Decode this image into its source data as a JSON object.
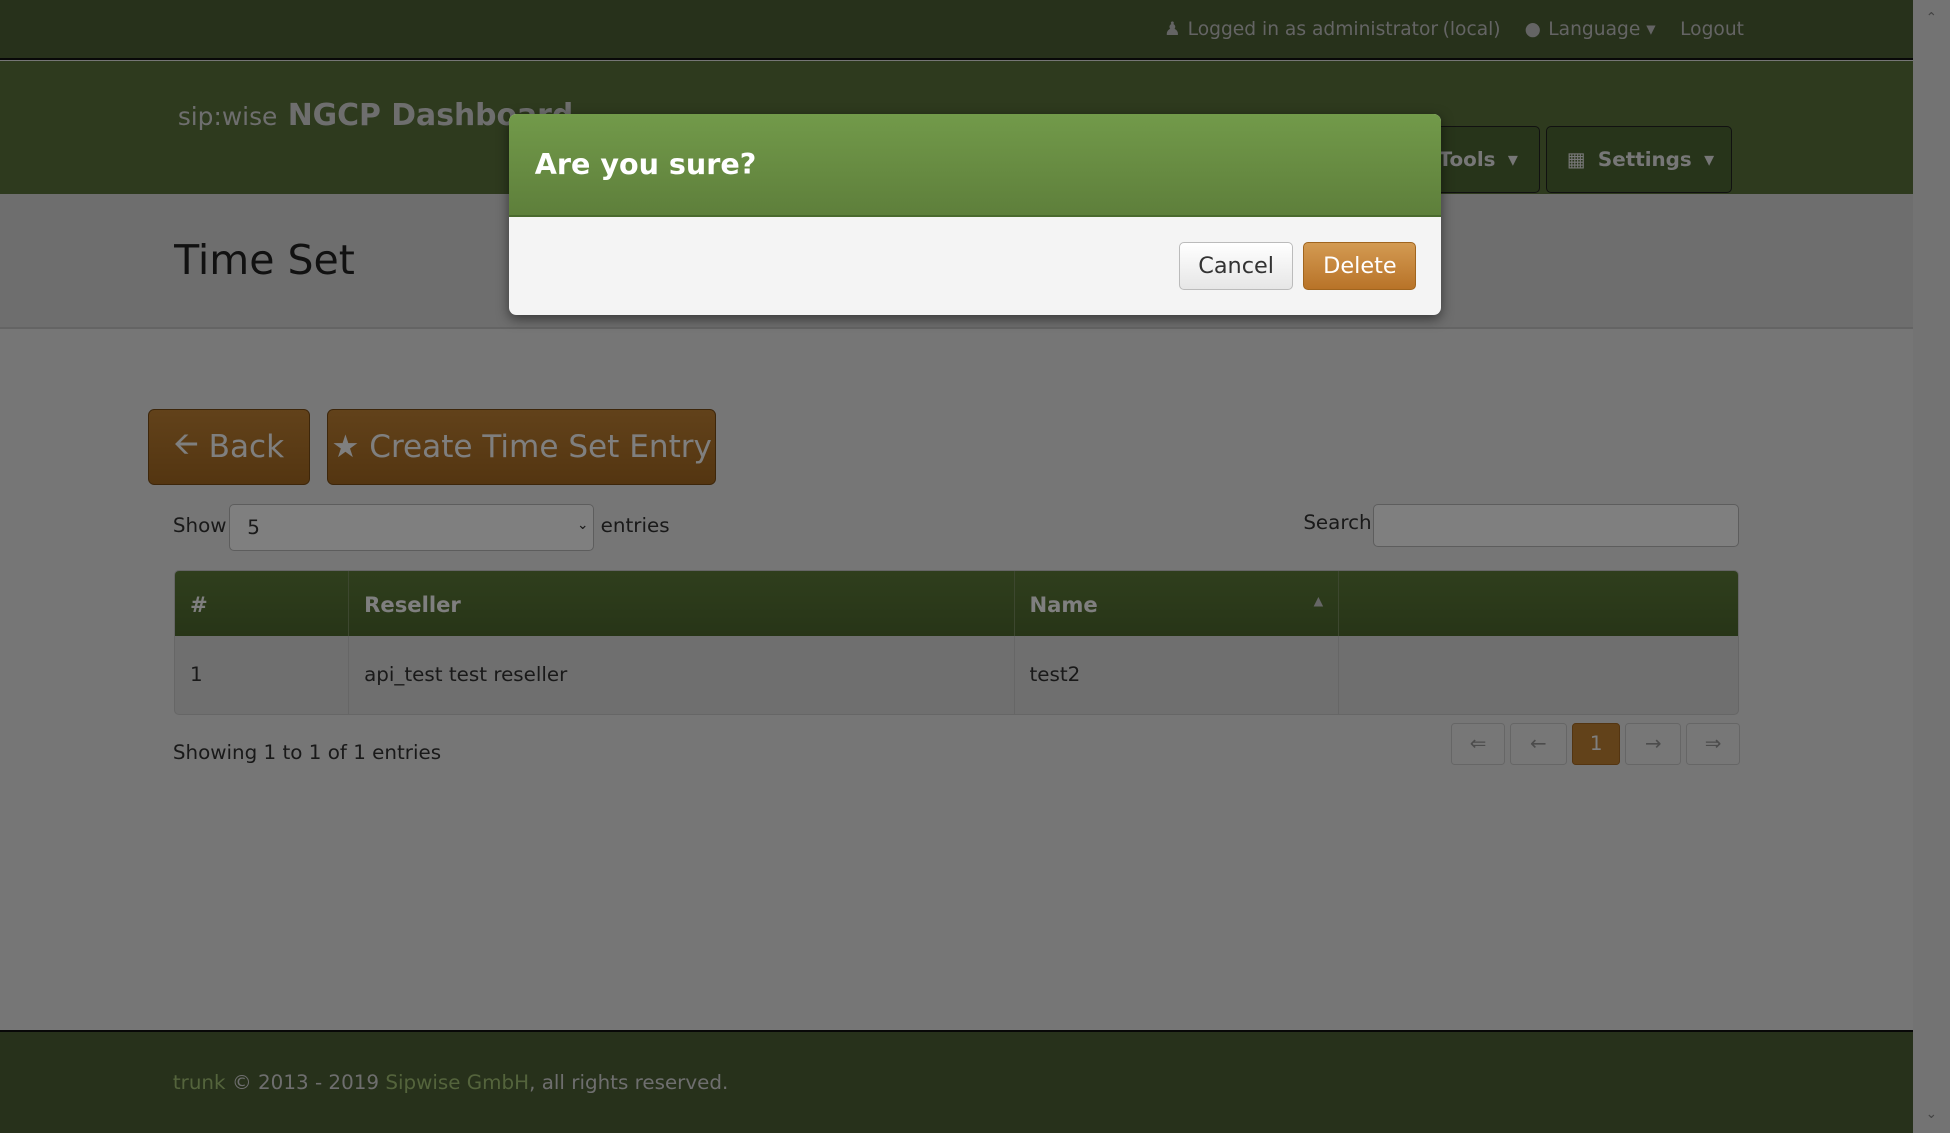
{
  "topbar": {
    "logged_in": "Logged in as administrator",
    "realm": "(local)",
    "language": "Language",
    "logout": "Logout"
  },
  "header": {
    "logo_text": "sip:wise",
    "app_title": "NGCP Dashboard",
    "nav": [
      {
        "label": "Tools"
      },
      {
        "label": "Settings"
      }
    ]
  },
  "page": {
    "title": "Time Set",
    "back": "Back",
    "create": "Create Time Set Entry"
  },
  "table_controls": {
    "show": "Show",
    "page_size": "5",
    "entries": "entries",
    "search": "Search:",
    "search_value": ""
  },
  "table": {
    "columns": [
      "#",
      "Reseller",
      "Name",
      ""
    ],
    "rows": [
      [
        "1",
        "api_test test reseller",
        "test2",
        ""
      ]
    ]
  },
  "pagination": {
    "info": "Showing 1 to 1 of 1 entries",
    "first": "⇐",
    "prev": "←",
    "current": "1",
    "next": "→",
    "last": "⇒"
  },
  "footer": {
    "version": "trunk",
    "copy": " © 2013 - 2019 ",
    "company": "Sipwise GmbH",
    "rights": ", all rights reserved."
  },
  "modal": {
    "title": "Are you sure?",
    "cancel": "Cancel",
    "delete": "Delete"
  },
  "colors": {
    "brand_green": "#5c753c",
    "accent_orange": "#c48435"
  }
}
